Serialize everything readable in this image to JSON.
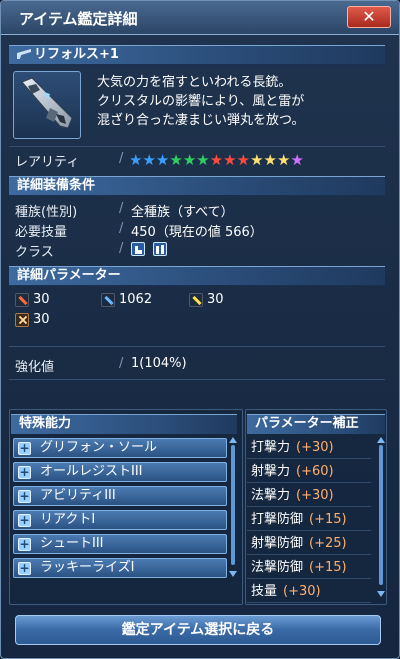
{
  "window": {
    "title": "アイテム鑑定詳細",
    "close_label": "✕"
  },
  "item": {
    "name": "リフォルス+1",
    "description": "大気の力を宿すといわれる長銃。\nクリスタルの影響により、風と雷が\n混ざり合った凄まじい弾丸を放つ。",
    "rarity_label": "レアリティ",
    "rarity_stars": 13,
    "star_colors": [
      "#3aa0ff",
      "#3aa0ff",
      "#3aa0ff",
      "#2cd060",
      "#2cd060",
      "#2cd060",
      "#ff4a3a",
      "#ff4a3a",
      "#ff4a3a",
      "#ffe070",
      "#ffe070",
      "#ffe070",
      "#d070ff"
    ]
  },
  "requirements": {
    "header": "詳細装備条件",
    "race_label": "種族(性別)",
    "race_value": "全種族（すべて）",
    "skill_label": "必要技量",
    "skill_value": "450（現在の値 566）",
    "class_label": "クラス",
    "class_icons": [
      "ranger-class-icon",
      "gunner-class-icon"
    ]
  },
  "parameters": {
    "header": "詳細パラメーター",
    "attack_strike": "30",
    "attack_range": "1062",
    "attack_tech": "30",
    "element": "30",
    "enhance_label": "強化値",
    "enhance_value": "1(104%)"
  },
  "abilities": {
    "header": "特殊能力",
    "items": [
      "グリフォン・ソール",
      "オールレジストIII",
      "アビリティIII",
      "リアクトI",
      "シュートIII",
      "ラッキーライズI"
    ]
  },
  "bonuses": {
    "header": "パラメーター補正",
    "items": [
      {
        "name": "打撃力",
        "value": "(+30)"
      },
      {
        "name": "射撃力",
        "value": "(+60)"
      },
      {
        "name": "法撃力",
        "value": "(+30)"
      },
      {
        "name": "打撃防御",
        "value": "(+15)"
      },
      {
        "name": "射撃防御",
        "value": "(+25)"
      },
      {
        "name": "法撃防御",
        "value": "(+15)"
      },
      {
        "name": "技量",
        "value": "(+30)"
      }
    ]
  },
  "footer": {
    "back_label": "鑑定アイテム選択に戻る"
  }
}
